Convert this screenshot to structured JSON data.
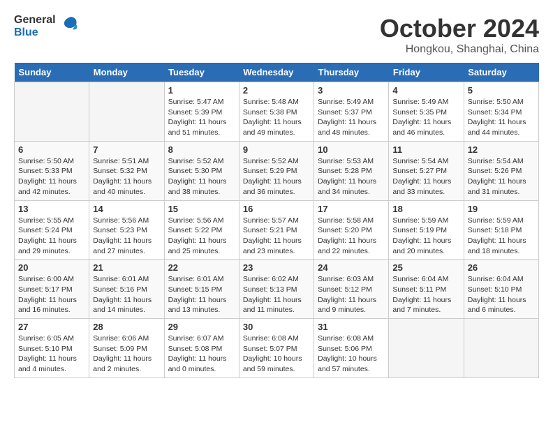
{
  "logo": {
    "general": "General",
    "blue": "Blue"
  },
  "title": "October 2024",
  "subtitle": "Hongkou, Shanghai, China",
  "headers": [
    "Sunday",
    "Monday",
    "Tuesday",
    "Wednesday",
    "Thursday",
    "Friday",
    "Saturday"
  ],
  "weeks": [
    [
      {
        "day": "",
        "info": ""
      },
      {
        "day": "",
        "info": ""
      },
      {
        "day": "1",
        "info": "Sunrise: 5:47 AM\nSunset: 5:39 PM\nDaylight: 11 hours\nand 51 minutes."
      },
      {
        "day": "2",
        "info": "Sunrise: 5:48 AM\nSunset: 5:38 PM\nDaylight: 11 hours\nand 49 minutes."
      },
      {
        "day": "3",
        "info": "Sunrise: 5:49 AM\nSunset: 5:37 PM\nDaylight: 11 hours\nand 48 minutes."
      },
      {
        "day": "4",
        "info": "Sunrise: 5:49 AM\nSunset: 5:35 PM\nDaylight: 11 hours\nand 46 minutes."
      },
      {
        "day": "5",
        "info": "Sunrise: 5:50 AM\nSunset: 5:34 PM\nDaylight: 11 hours\nand 44 minutes."
      }
    ],
    [
      {
        "day": "6",
        "info": "Sunrise: 5:50 AM\nSunset: 5:33 PM\nDaylight: 11 hours\nand 42 minutes."
      },
      {
        "day": "7",
        "info": "Sunrise: 5:51 AM\nSunset: 5:32 PM\nDaylight: 11 hours\nand 40 minutes."
      },
      {
        "day": "8",
        "info": "Sunrise: 5:52 AM\nSunset: 5:30 PM\nDaylight: 11 hours\nand 38 minutes."
      },
      {
        "day": "9",
        "info": "Sunrise: 5:52 AM\nSunset: 5:29 PM\nDaylight: 11 hours\nand 36 minutes."
      },
      {
        "day": "10",
        "info": "Sunrise: 5:53 AM\nSunset: 5:28 PM\nDaylight: 11 hours\nand 34 minutes."
      },
      {
        "day": "11",
        "info": "Sunrise: 5:54 AM\nSunset: 5:27 PM\nDaylight: 11 hours\nand 33 minutes."
      },
      {
        "day": "12",
        "info": "Sunrise: 5:54 AM\nSunset: 5:26 PM\nDaylight: 11 hours\nand 31 minutes."
      }
    ],
    [
      {
        "day": "13",
        "info": "Sunrise: 5:55 AM\nSunset: 5:24 PM\nDaylight: 11 hours\nand 29 minutes."
      },
      {
        "day": "14",
        "info": "Sunrise: 5:56 AM\nSunset: 5:23 PM\nDaylight: 11 hours\nand 27 minutes."
      },
      {
        "day": "15",
        "info": "Sunrise: 5:56 AM\nSunset: 5:22 PM\nDaylight: 11 hours\nand 25 minutes."
      },
      {
        "day": "16",
        "info": "Sunrise: 5:57 AM\nSunset: 5:21 PM\nDaylight: 11 hours\nand 23 minutes."
      },
      {
        "day": "17",
        "info": "Sunrise: 5:58 AM\nSunset: 5:20 PM\nDaylight: 11 hours\nand 22 minutes."
      },
      {
        "day": "18",
        "info": "Sunrise: 5:59 AM\nSunset: 5:19 PM\nDaylight: 11 hours\nand 20 minutes."
      },
      {
        "day": "19",
        "info": "Sunrise: 5:59 AM\nSunset: 5:18 PM\nDaylight: 11 hours\nand 18 minutes."
      }
    ],
    [
      {
        "day": "20",
        "info": "Sunrise: 6:00 AM\nSunset: 5:17 PM\nDaylight: 11 hours\nand 16 minutes."
      },
      {
        "day": "21",
        "info": "Sunrise: 6:01 AM\nSunset: 5:16 PM\nDaylight: 11 hours\nand 14 minutes."
      },
      {
        "day": "22",
        "info": "Sunrise: 6:01 AM\nSunset: 5:15 PM\nDaylight: 11 hours\nand 13 minutes."
      },
      {
        "day": "23",
        "info": "Sunrise: 6:02 AM\nSunset: 5:13 PM\nDaylight: 11 hours\nand 11 minutes."
      },
      {
        "day": "24",
        "info": "Sunrise: 6:03 AM\nSunset: 5:12 PM\nDaylight: 11 hours\nand 9 minutes."
      },
      {
        "day": "25",
        "info": "Sunrise: 6:04 AM\nSunset: 5:11 PM\nDaylight: 11 hours\nand 7 minutes."
      },
      {
        "day": "26",
        "info": "Sunrise: 6:04 AM\nSunset: 5:10 PM\nDaylight: 11 hours\nand 6 minutes."
      }
    ],
    [
      {
        "day": "27",
        "info": "Sunrise: 6:05 AM\nSunset: 5:10 PM\nDaylight: 11 hours\nand 4 minutes."
      },
      {
        "day": "28",
        "info": "Sunrise: 6:06 AM\nSunset: 5:09 PM\nDaylight: 11 hours\nand 2 minutes."
      },
      {
        "day": "29",
        "info": "Sunrise: 6:07 AM\nSunset: 5:08 PM\nDaylight: 11 hours\nand 0 minutes."
      },
      {
        "day": "30",
        "info": "Sunrise: 6:08 AM\nSunset: 5:07 PM\nDaylight: 10 hours\nand 59 minutes."
      },
      {
        "day": "31",
        "info": "Sunrise: 6:08 AM\nSunset: 5:06 PM\nDaylight: 10 hours\nand 57 minutes."
      },
      {
        "day": "",
        "info": ""
      },
      {
        "day": "",
        "info": ""
      }
    ]
  ]
}
